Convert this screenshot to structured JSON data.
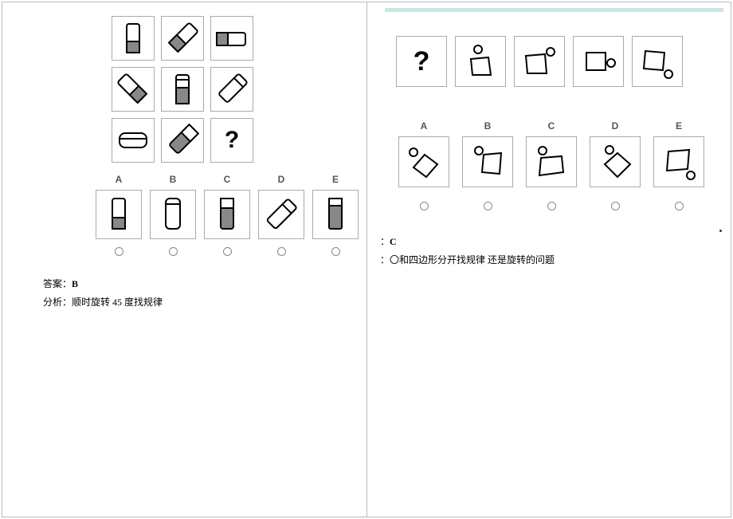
{
  "left": {
    "labels": [
      "A",
      "B",
      "C",
      "D",
      "E"
    ],
    "answer_label": "答案：",
    "answer_value": "B",
    "analysis_label": "分析：",
    "analysis_text_prefix": "顺时旋转 ",
    "analysis_number": "45",
    "analysis_text_suffix": " 度找规律"
  },
  "right": {
    "qmark": "?",
    "labels": [
      "A",
      "B",
      "C",
      "D",
      "E"
    ],
    "answer_line_prefix": "：",
    "answer_value": "C",
    "analysis_prefix": "：",
    "analysis_text": "〇和四边形分开找规律  还是旋转的问题"
  }
}
